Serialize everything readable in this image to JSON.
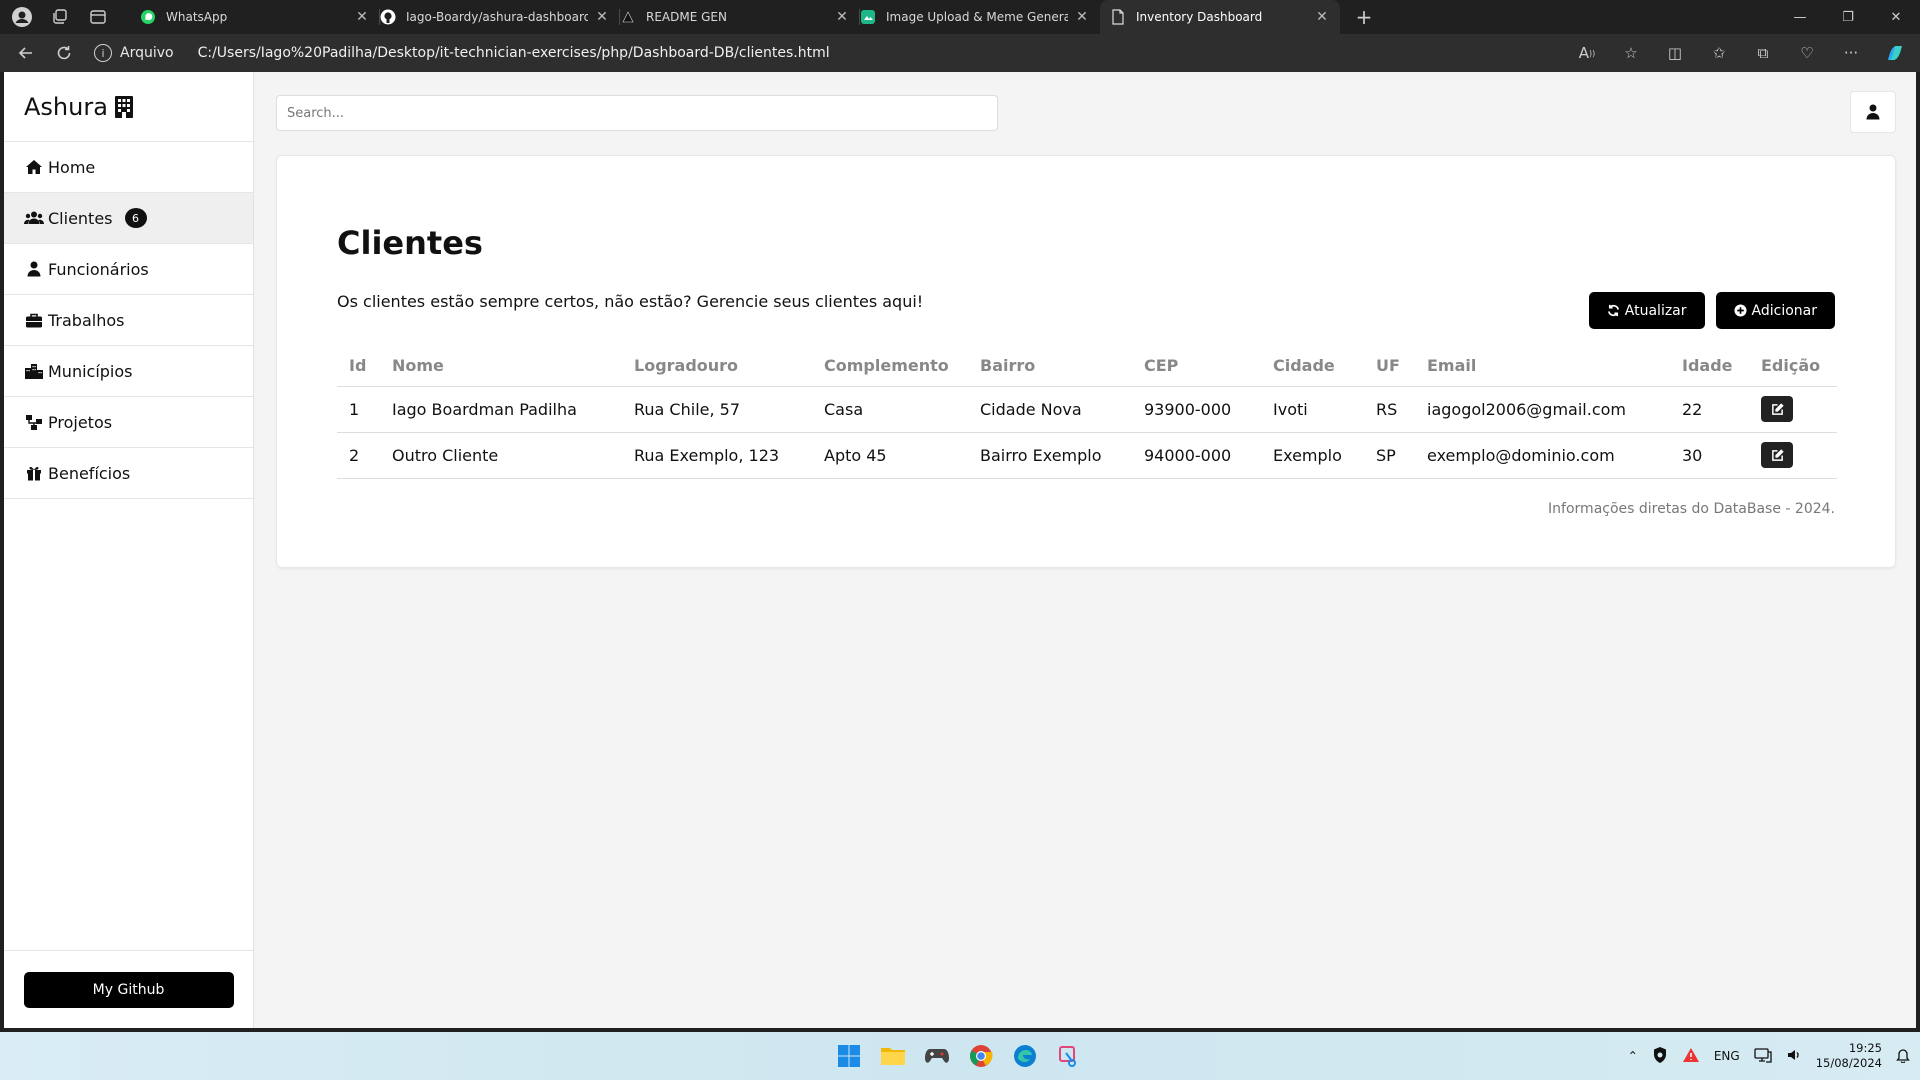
{
  "browser": {
    "tabs": [
      {
        "title": "WhatsApp",
        "icon": "whatsapp-icon"
      },
      {
        "title": "Iago-Boardy/ashura-dashboard: ",
        "icon": "github-icon"
      },
      {
        "title": "README GEN",
        "icon": "readme-icon"
      },
      {
        "title": "Image Upload & Meme Generati",
        "icon": "meme-icon"
      },
      {
        "title": "Inventory Dashboard",
        "icon": "page-icon",
        "active": true
      }
    ],
    "address": {
      "scheme_label": "Arquivo",
      "url": "C:/Users/Iago%20Padilha/Desktop/it-technician-exercises/php/Dashboard-DB/clientes.html"
    }
  },
  "sidebar": {
    "brand": "Ashura",
    "items": [
      {
        "label": "Home",
        "icon": "home-icon"
      },
      {
        "label": "Clientes",
        "icon": "users-icon",
        "badge": "6",
        "active": true
      },
      {
        "label": "Funcionários",
        "icon": "user-icon"
      },
      {
        "label": "Trabalhos",
        "icon": "briefcase-icon"
      },
      {
        "label": "Municípios",
        "icon": "city-icon"
      },
      {
        "label": "Projetos",
        "icon": "sitemap-icon"
      },
      {
        "label": "Benefícios",
        "icon": "gift-icon"
      }
    ],
    "github_button": "My Github"
  },
  "header": {
    "search_placeholder": "Search..."
  },
  "page": {
    "title": "Clientes",
    "subtitle": "Os clientes estão sempre certos, não estão? Gerencie seus clientes aqui!",
    "refresh_button": "Atualizar",
    "add_button": "Adicionar",
    "table": {
      "headers": [
        "Id",
        "Nome",
        "Logradouro",
        "Complemento",
        "Bairro",
        "CEP",
        "Cidade",
        "UF",
        "Email",
        "Idade",
        "Edição"
      ],
      "rows": [
        [
          "1",
          "Iago Boardman Padilha",
          "Rua Chile, 57",
          "Casa",
          "Cidade Nova",
          "93900-000",
          "Ivoti",
          "RS",
          "iagogol2006@gmail.com",
          "22"
        ],
        [
          "2",
          "Outro Cliente",
          "Rua Exemplo, 123",
          "Apto 45",
          "Bairro Exemplo",
          "94000-000",
          "Exemplo",
          "SP",
          "exemplo@dominio.com",
          "30"
        ]
      ]
    },
    "footnote": "Informações diretas do DataBase - 2024."
  },
  "taskbar": {
    "language": "ENG",
    "time": "19:25",
    "date": "15/08/2024"
  }
}
